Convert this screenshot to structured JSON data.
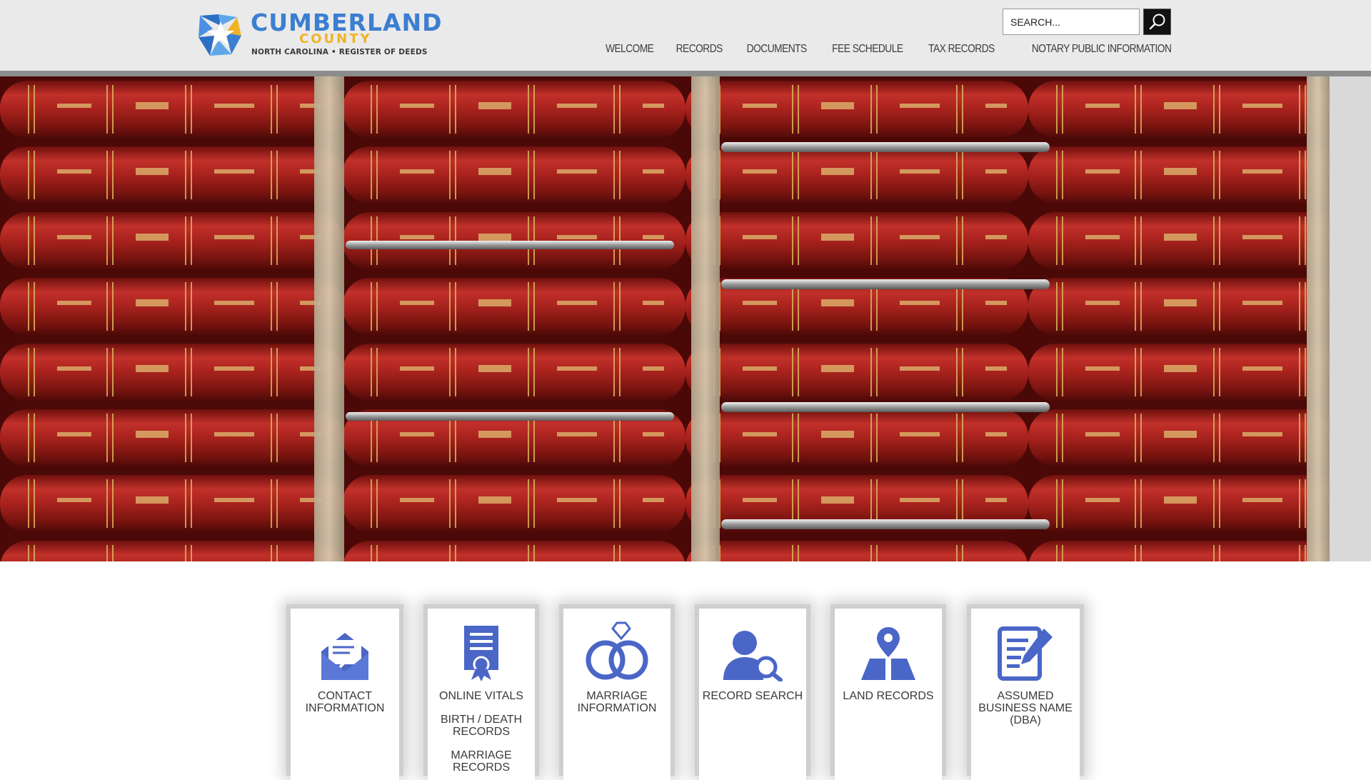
{
  "brand": {
    "title": "CUMBERLAND",
    "subtitle": "COUNTY",
    "tagline": "NORTH CAROLINA • REGISTER OF DEEDS",
    "primary_color": "#3b7fd0",
    "accent_color": "#f0b323"
  },
  "search": {
    "placeholder": "SEARCH...",
    "button_icon": "search-icon"
  },
  "nav": {
    "items": [
      {
        "label": "Welcome"
      },
      {
        "label": "Records"
      },
      {
        "label": "Documents"
      },
      {
        "label": "Fee Schedule"
      },
      {
        "label": "Tax Records"
      },
      {
        "label": "Notary Public Information"
      }
    ]
  },
  "hero": {
    "description_icon": "record-books-photo"
  },
  "cards": [
    {
      "label": "Contact Information",
      "icon": "contact-envelope-icon"
    },
    {
      "label": "Online Vitals",
      "icon": "certificate-icon",
      "links": [
        "Birth / Death Records",
        "Marriage Records"
      ]
    },
    {
      "label": "Marriage Information",
      "icon": "wedding-rings-icon"
    },
    {
      "label": "Record Search",
      "icon": "person-search-icon"
    },
    {
      "label": "Land Records",
      "icon": "map-pin-icon"
    },
    {
      "label": "Assumed Business Name (DBA)",
      "icon": "document-edit-icon"
    }
  ],
  "icon_color": "#4a66c7"
}
